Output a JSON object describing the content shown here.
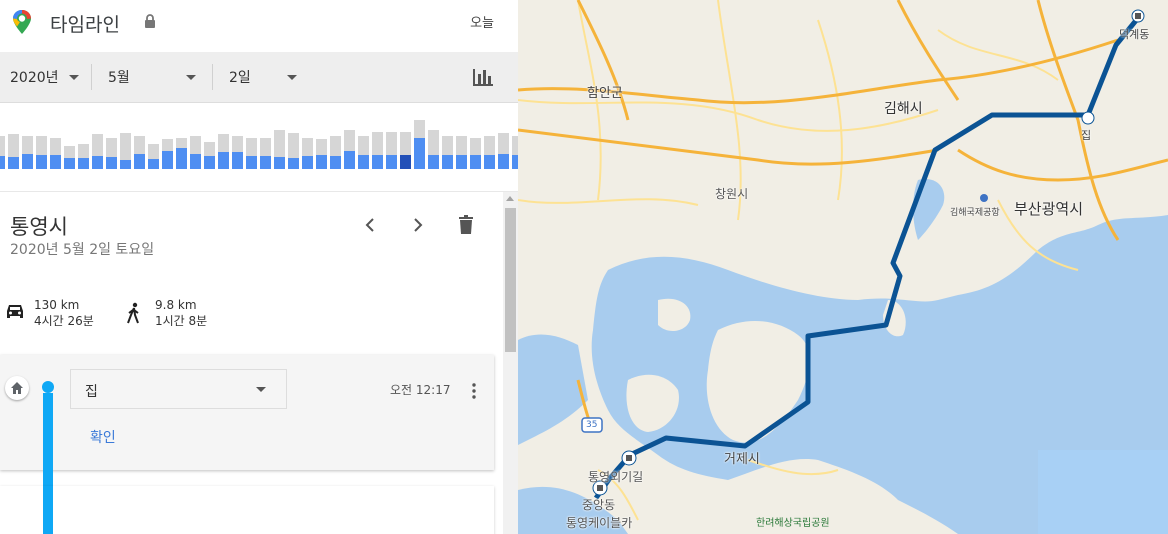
{
  "app": {
    "title": "타임라인",
    "today_label": "오늘"
  },
  "icons": {
    "brand": "google-maps-pin-icon",
    "lock": "lock-icon",
    "chart": "bar-chart-icon",
    "prev": "chevron-left-icon",
    "next": "chevron-right-icon",
    "delete": "trash-icon",
    "car": "car-icon",
    "walk": "walking-icon",
    "home": "home-icon",
    "more": "more-vert-icon"
  },
  "date_selector": {
    "year": "2020년",
    "month": "5월",
    "day": "2일"
  },
  "histogram": {
    "grey_values": [
      0.55,
      0.58,
      0.55,
      0.55,
      0.52,
      0.38,
      0.42,
      0.58,
      0.52,
      0.6,
      0.55,
      0.42,
      0.5,
      0.52,
      0.55,
      0.45,
      0.58,
      0.55,
      0.52,
      0.52,
      0.65,
      0.6,
      0.52,
      0.5,
      0.55,
      0.65,
      0.55,
      0.62,
      0.62,
      0.62,
      0.82,
      0.65,
      0.55,
      0.55,
      0.52,
      0.55,
      0.6,
      0.55,
      0.8,
      0.72,
      0.72,
      0.58,
      0.2
    ],
    "blue_values": [
      0.22,
      0.2,
      0.25,
      0.24,
      0.24,
      0.18,
      0.18,
      0.22,
      0.2,
      0.15,
      0.25,
      0.17,
      0.3,
      0.35,
      0.25,
      0.22,
      0.28,
      0.28,
      0.22,
      0.22,
      0.2,
      0.18,
      0.22,
      0.24,
      0.22,
      0.3,
      0.24,
      0.24,
      0.24,
      0.24,
      0.52,
      0.24,
      0.24,
      0.24,
      0.24,
      0.24,
      0.25,
      0.24,
      0.36,
      0.35,
      0.22,
      0.22,
      0.06
    ],
    "selected_index": 29,
    "colors": {
      "grey": "#d6d6d6",
      "blue": "#4e8ef2",
      "selected": "#2250b8"
    }
  },
  "summary": {
    "place": "통영시",
    "date": "2020년 5월 2일 토요일",
    "drive": {
      "distance": "130 km",
      "duration": "4시간 26분"
    },
    "walk": {
      "distance": "9.8 km",
      "duration": "1시간 8분"
    }
  },
  "timeline": {
    "entries": [
      {
        "place": "집",
        "time": "오전 12:17",
        "action": "확인"
      }
    ]
  },
  "map": {
    "labels": {
      "haman": "함안군",
      "gimhae": "김해시",
      "changwon": "창원시",
      "gimhae_airport": "김해국제공항",
      "busan": "부산광역시",
      "geoje": "거제시",
      "deokgye": "덕계동",
      "home_pin": "집",
      "tongyeong_route": "통영외기길",
      "jungang": "중앙동",
      "cablecar": "통영케이블카",
      "marine_park": "한려해상국립공원",
      "highway": "35"
    },
    "colors": {
      "land": "#f1eee5",
      "sea": "#a8ccee",
      "route": "#0b5394",
      "road_major": "#f5b33a",
      "road_minor": "#fde293"
    }
  }
}
